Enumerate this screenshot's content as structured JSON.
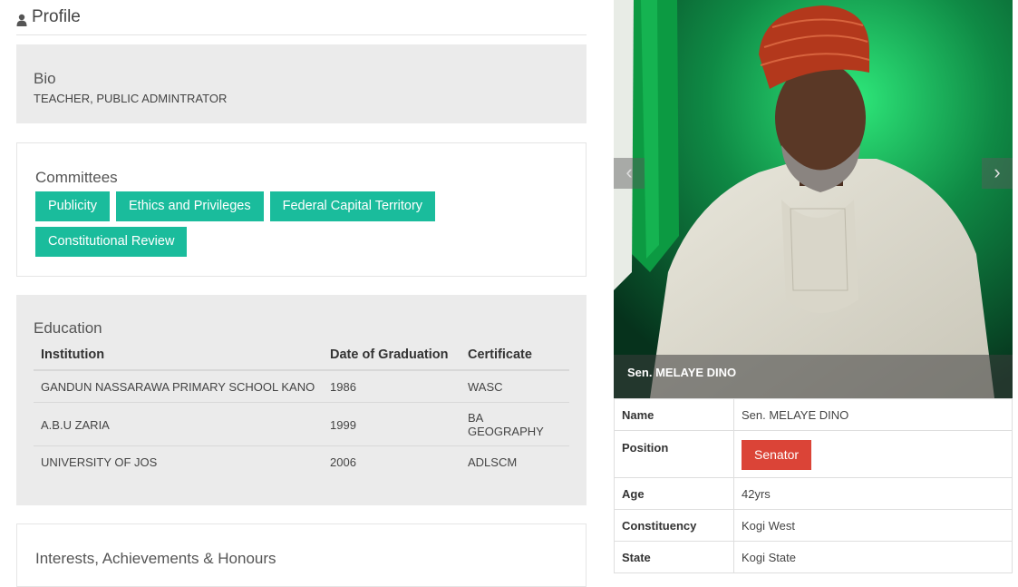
{
  "header": {
    "title": "Profile",
    "icon": "user-icon"
  },
  "bio": {
    "title": "Bio",
    "text": "TEACHER, PUBLIC ADMINTRATOR"
  },
  "committees": {
    "title": "Committees",
    "items": [
      "Publicity",
      "Ethics and Privileges",
      "Federal Capital Territory",
      "Constitutional Review"
    ],
    "color": "#1abc9c"
  },
  "education": {
    "title": "Education",
    "columns": [
      "Institution",
      "Date of Graduation",
      "Certificate"
    ],
    "rows": [
      [
        "GANDUN NASSARAWA PRIMARY SCHOOL KANO",
        "1986",
        "WASC"
      ],
      [
        "A.B.U ZARIA",
        "1999",
        "BA GEOGRAPHY"
      ],
      [
        "UNIVERSITY OF JOS",
        "2006",
        "ADLSCM"
      ]
    ]
  },
  "interests": {
    "title": "Interests, Achievements & Honours"
  },
  "carousel": {
    "caption": "Sen. MELAYE DINO",
    "prev_icon": "chevron-left-icon",
    "next_icon": "chevron-right-icon"
  },
  "info": {
    "name_label": "Name",
    "name_value": "Sen. MELAYE DINO",
    "position_label": "Position",
    "position_value": "Senator",
    "age_label": "Age",
    "age_value": "42yrs",
    "constituency_label": "Constituency",
    "constituency_value": "Kogi West",
    "state_label": "State",
    "state_value": "Kogi State",
    "badge_color": "#db4437"
  }
}
